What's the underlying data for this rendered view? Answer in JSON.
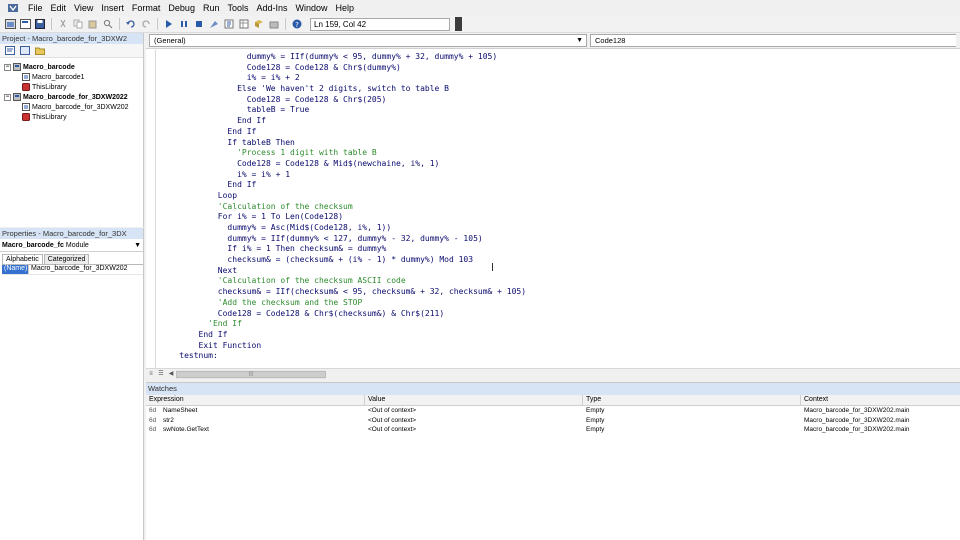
{
  "menu": [
    "File",
    "Edit",
    "View",
    "Insert",
    "Format",
    "Debug",
    "Run",
    "Tools",
    "Add-Ins",
    "Window",
    "Help"
  ],
  "toolbar": {
    "cursor_position": "Ln 159, Col 42"
  },
  "project": {
    "title": "Project - Macro_barcode_for_3DXW2",
    "tree": [
      {
        "label": "Macro_barcode",
        "level": 0,
        "icon": "project-icon"
      },
      {
        "label": "Macro_barcode1",
        "level": 1,
        "icon": "module-icon"
      },
      {
        "label": "ThisLibrary",
        "level": 1,
        "icon": "library-icon"
      },
      {
        "label": "Macro_barcode_for_3DXW2022",
        "level": 0,
        "icon": "project-icon"
      },
      {
        "label": "Macro_barcode_for_3DXW202",
        "level": 1,
        "icon": "module-icon"
      },
      {
        "label": "ThisLibrary",
        "level": 1,
        "icon": "library-icon"
      }
    ]
  },
  "properties": {
    "title": "Properties - Macro_barcode_for_3DX",
    "object_name": "Macro_barcode_fc",
    "object_type": "Module",
    "tabs": [
      "Alphabetic",
      "Categorized"
    ],
    "rows": [
      {
        "name": "(Name)",
        "value": "Macro_barcode_for_3DXW202"
      }
    ]
  },
  "code": {
    "object_combo": "(General)",
    "proc_combo": "Code128",
    "lines": [
      {
        "text": "                  dummy% = IIf(dummy% < 95, dummy% + 32, dummy% + 105)",
        "type": "code"
      },
      {
        "text": "                  Code128 = Code128 & Chr$(dummy%)",
        "type": "code"
      },
      {
        "text": "                  i% = i% + 2",
        "type": "code"
      },
      {
        "text": "                Else 'We haven't 2 digits, switch to table B",
        "type": "code"
      },
      {
        "text": "                  Code128 = Code128 & Chr$(205)",
        "type": "code"
      },
      {
        "text": "                  tableB = True",
        "type": "code"
      },
      {
        "text": "                End If",
        "type": "code"
      },
      {
        "text": "              End If",
        "type": "code"
      },
      {
        "text": "              If tableB Then",
        "type": "code"
      },
      {
        "text": "                'Process 1 digit with table B",
        "type": "comment"
      },
      {
        "text": "                Code128 = Code128 & Mid$(newchaine, i%, 1)",
        "type": "code"
      },
      {
        "text": "                i% = i% + 1",
        "type": "code"
      },
      {
        "text": "              End If",
        "type": "code"
      },
      {
        "text": "            Loop",
        "type": "code"
      },
      {
        "text": "            'Calculation of the checksum",
        "type": "comment"
      },
      {
        "text": "            For i% = 1 To Len(Code128)",
        "type": "code"
      },
      {
        "text": "              dummy% = Asc(Mid$(Code128, i%, 1))",
        "type": "code"
      },
      {
        "text": "              dummy% = IIf(dummy% < 127, dummy% - 32, dummy% - 105)",
        "type": "code"
      },
      {
        "text": "              If i% = 1 Then checksum& = dummy%",
        "type": "code"
      },
      {
        "text": "              checksum& = (checksum& + (i% - 1) * dummy%) Mod 103",
        "type": "code"
      },
      {
        "text": "            Next",
        "type": "code"
      },
      {
        "text": "            'Calculation of the checksum ASCII code",
        "type": "comment"
      },
      {
        "text": "            checksum& = IIf(checksum& < 95, checksum& + 32, checksum& + 105)",
        "type": "code"
      },
      {
        "text": "            'Add the checksum and the STOP",
        "type": "comment"
      },
      {
        "text": "            Code128 = Code128 & Chr$(checksum&) & Chr$(211)",
        "type": "code"
      },
      {
        "text": "          'End If",
        "type": "comment"
      },
      {
        "text": "        End If",
        "type": "code"
      },
      {
        "text": "        Exit Function",
        "type": "code"
      },
      {
        "text": "    testnum:",
        "type": "code"
      }
    ]
  },
  "watches": {
    "title": "Watches",
    "columns": [
      "Expression",
      "Value",
      "Type",
      "Context"
    ],
    "rows": [
      {
        "icon": "6d",
        "expression": "NameSheet",
        "value": "<Out of context>",
        "type": "Empty",
        "context": "Macro_barcode_for_3DXW202.main"
      },
      {
        "icon": "6d",
        "expression": "str2",
        "value": "<Out of context>",
        "type": "Empty",
        "context": "Macro_barcode_for_3DXW202.main"
      },
      {
        "icon": "6d",
        "expression": "swNote.GetText",
        "value": "<Out of context>",
        "type": "Empty",
        "context": "Macro_barcode_for_3DXW202.main"
      }
    ]
  }
}
